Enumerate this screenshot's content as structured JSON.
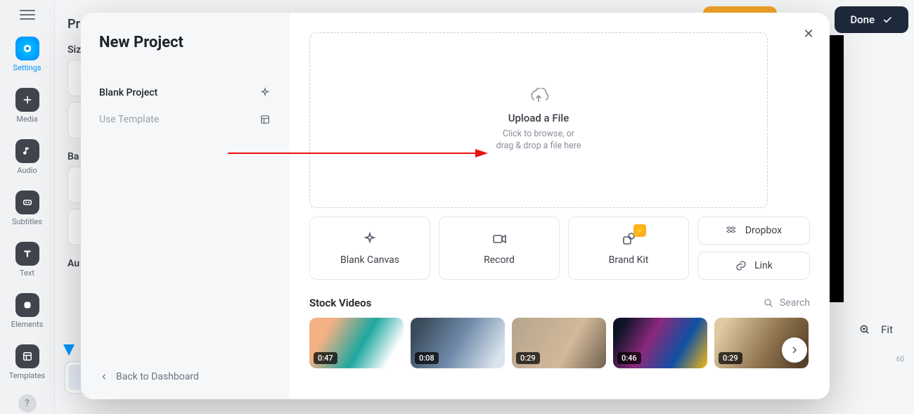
{
  "rail": {
    "items": [
      {
        "label": "Settings"
      },
      {
        "label": "Media"
      },
      {
        "label": "Audio"
      },
      {
        "label": "Subtitles"
      },
      {
        "label": "Text"
      },
      {
        "label": "Elements"
      },
      {
        "label": "Templates"
      }
    ]
  },
  "header": {
    "done": "Done"
  },
  "panel": {
    "title_cut": "Pr",
    "size_cut": "Siz",
    "bg_cut": "Ba",
    "audio_cut": "Au"
  },
  "viewport": {
    "fit": "Fit",
    "timeline_end": "60"
  },
  "modal": {
    "title": "New Project",
    "items": [
      {
        "label": "Blank Project"
      },
      {
        "label": "Use Template"
      }
    ],
    "back": "Back to Dashboard",
    "drop": {
      "title": "Upload a File",
      "sub1": "Click to browse, or",
      "sub2": "drag & drop a file here"
    },
    "cards": {
      "blank": "Blank Canvas",
      "record": "Record",
      "brand": "Brand Kit",
      "dropbox": "Dropbox",
      "link": "Link"
    },
    "stock": {
      "title": "Stock Videos",
      "search": "Search",
      "items": [
        {
          "dur": "0:47"
        },
        {
          "dur": "0:08"
        },
        {
          "dur": "0:29"
        },
        {
          "dur": "0:46"
        },
        {
          "dur": "0:29"
        }
      ]
    }
  }
}
